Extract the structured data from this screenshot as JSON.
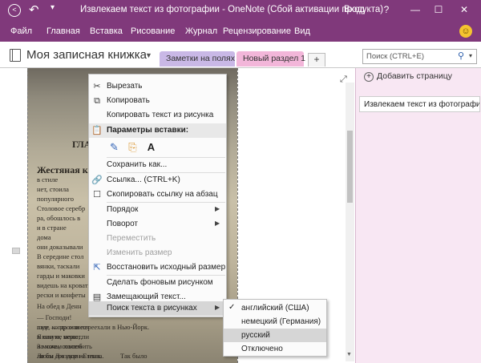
{
  "titlebar": {
    "title": "Извлекаем текст из фотографии  -  OneNote (Сбой активации продукта)",
    "signin": "Вход",
    "help": "?",
    "minimize": "—",
    "maximize": "☐",
    "close": "✕"
  },
  "ribbon": {
    "tabs": [
      "Файл",
      "Главная",
      "Вставка",
      "Рисование",
      "Журнал",
      "Рецензирование",
      "Вид"
    ]
  },
  "notebook": {
    "name": "Моя записная книжка",
    "sections": [
      "Заметки на полях",
      "Новый раздел 1"
    ],
    "add_section": "+"
  },
  "search": {
    "placeholder": "Поиск (CTRL+E)"
  },
  "pages": {
    "add_page": "Добавить страницу",
    "items": [
      "Извлекаем текст из фотографии"
    ]
  },
  "photo_text": {
    "lines": [
      "ГЛА",
      "Жестяная коп",
      "в стиле",
      "нет, стоила",
      "популярного",
      "Столовое серебр",
      "ра, обошлось в",
      "и в стране",
      "дома",
      "они доказывали",
      "В середине стол",
      "вянки, таскали",
      "гарды и маковки",
      "видешь на кровати",
      "рески и конфеты",
      "На обед в Денн",
      "— Господи!",
      "лзде — произнеся",
      "в какую, может,",
      "За ночь, совсем",
      "Люси Джэдсон-Гленн.",
      "шее, когда они переехали в Нью-Йорк.",
      "Я вам не верю, пи",
      "и можем полюбить",
      "Так было",
      "ли бы его еще на глаза."
    ]
  },
  "context_menu": {
    "cut": "Вырезать",
    "copy": "Копировать",
    "copy_text": "Копировать текст из рисунка",
    "paste_header": "Параметры вставки:",
    "save_as": "Сохранить как...",
    "link": "Ссылка...  (CTRL+K)",
    "copy_link": "Скопировать ссылку на абзац",
    "order": "Порядок",
    "rotate": "Поворот",
    "move": "Переместить",
    "resize": "Изменить размер",
    "restore_size": "Восстановить исходный размер",
    "set_background": "Сделать фоновым рисунком",
    "alt_text": "Замещающий текст...",
    "ocr": "Поиск текста в рисунках"
  },
  "submenu": {
    "items": [
      "английский (США)",
      "немецкий (Германия)",
      "русский",
      "Отключено"
    ],
    "checked_index": 0,
    "highlight_index": 2,
    "check_mark": "✓"
  },
  "colors": {
    "accent": "#80397b",
    "section1": "#c9b8e6",
    "section2": "#f2b6d9",
    "page_panel": "#f8e7f3"
  }
}
